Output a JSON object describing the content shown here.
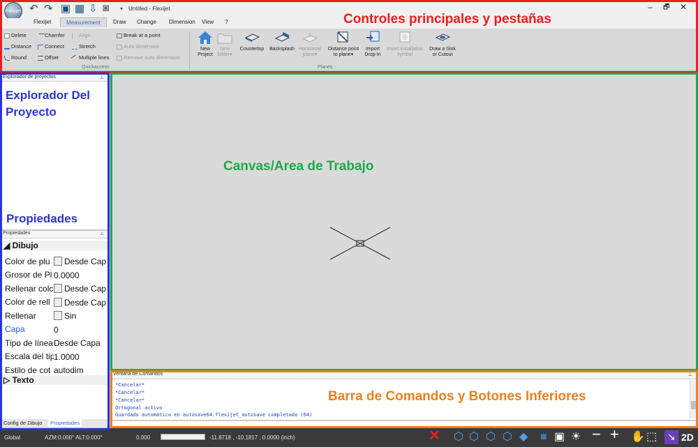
{
  "window": {
    "title": "Untitled - Flexijet",
    "logo_text": "Flexijet",
    "controls": [
      "–",
      "🗗",
      "✕"
    ]
  },
  "tabs": [
    "Flexijet",
    "Measurement",
    "Draw",
    "Change",
    "Dimension",
    "View",
    "?"
  ],
  "active_tab": "Measurement",
  "ribbon": {
    "quickaccess": {
      "label": "Quickaccess",
      "col1": [
        "Delete",
        "Distance",
        "Round"
      ],
      "col2": [
        "Chamfer",
        "Connect",
        "Offset"
      ],
      "col3": [
        "Align",
        "Stretch",
        "Multiple lines"
      ],
      "col4": [
        "Break at a point",
        "Auto dimension",
        "Remove auto dimension"
      ]
    },
    "planes": {
      "label": "Planes",
      "buttons": [
        {
          "label1": "New",
          "label2": "Project",
          "enabled": true,
          "icon": "house-icon"
        },
        {
          "label1": "New",
          "label2": "folder",
          "enabled": false,
          "icon": "folder-icon"
        },
        {
          "label1": "Countertop",
          "label2": "",
          "enabled": true,
          "icon": "countertop-icon"
        },
        {
          "label1": "Backsplash",
          "label2": "",
          "enabled": true,
          "icon": "backsplash-icon"
        },
        {
          "label1": "Horizontal",
          "label2": "plane",
          "enabled": false,
          "icon": "horizontal-plane-icon"
        },
        {
          "label1": "Distance point",
          "label2": "to plane",
          "enabled": true,
          "icon": "distance-point-icon"
        },
        {
          "label1": "Import",
          "label2": "Drop-In",
          "enabled": true,
          "icon": "import-icon"
        },
        {
          "label1": "Insert installation",
          "label2": "symbol",
          "enabled": false,
          "icon": "installation-symbol-icon"
        },
        {
          "label1": "Draw a Sink",
          "label2": "or Cutout",
          "enabled": true,
          "icon": "sink-icon"
        }
      ]
    }
  },
  "annotations": {
    "top": "Controles principales y pestañas",
    "explorer": "Explorador Del Proyecto",
    "properties": "Propiedades",
    "canvas": "Canvas/Area de Trabajo",
    "bottom": "Barra de Comandos y Botones Inferiores"
  },
  "colors": {
    "red": "#e8201f",
    "blue": "#2a35d6",
    "green": "#1fa84a",
    "orange": "#f07f1e"
  },
  "explorer": {
    "title": "Explorador de proyectos",
    "pin": "⊥"
  },
  "properties": {
    "title": "Propiedades",
    "pin": "⊥",
    "section": "Dibujo",
    "rows": [
      {
        "name": "Color de plu",
        "value": "Desde Cap",
        "swatch": true
      },
      {
        "name": "Grosor de Pl",
        "value": "0.0000",
        "swatch": false
      },
      {
        "name": "Rellenar colc",
        "value": "Desde Cap",
        "swatch": true
      },
      {
        "name": "Color de rell",
        "value": "Desde Cap",
        "swatch": true
      },
      {
        "name": "Rellenar",
        "value": "Sin",
        "swatch": true
      },
      {
        "name": "Capa",
        "value": "0",
        "swatch": false
      },
      {
        "name": "Tipo de línea",
        "value": "Desde Capa",
        "swatch": false
      },
      {
        "name": "Escala del tip",
        "value": "1.0000",
        "swatch": false
      },
      {
        "name": "Estilo de cot",
        "value": "autodim",
        "swatch": false
      }
    ],
    "section2": "Texto"
  },
  "bottom_tabs": [
    "Config de Dibujo",
    "Propiedades"
  ],
  "command": {
    "title": "Ventana de Comandos",
    "pin": "⊥",
    "lines": [
      "*Cancelar*",
      "*Cancelar*",
      "*Cancelar*",
      "Ortogonal activo",
      "Guardado automático en autosave64.flexijet_autosave completado (64)"
    ]
  },
  "statusbar": {
    "mode": "Global",
    "angles": "AZM:0.000° ALT:0.000°",
    "value": "0.000",
    "coords": "-11.8718 , -10.1817 , 0.0000 (inch)",
    "view2d": "2D"
  }
}
